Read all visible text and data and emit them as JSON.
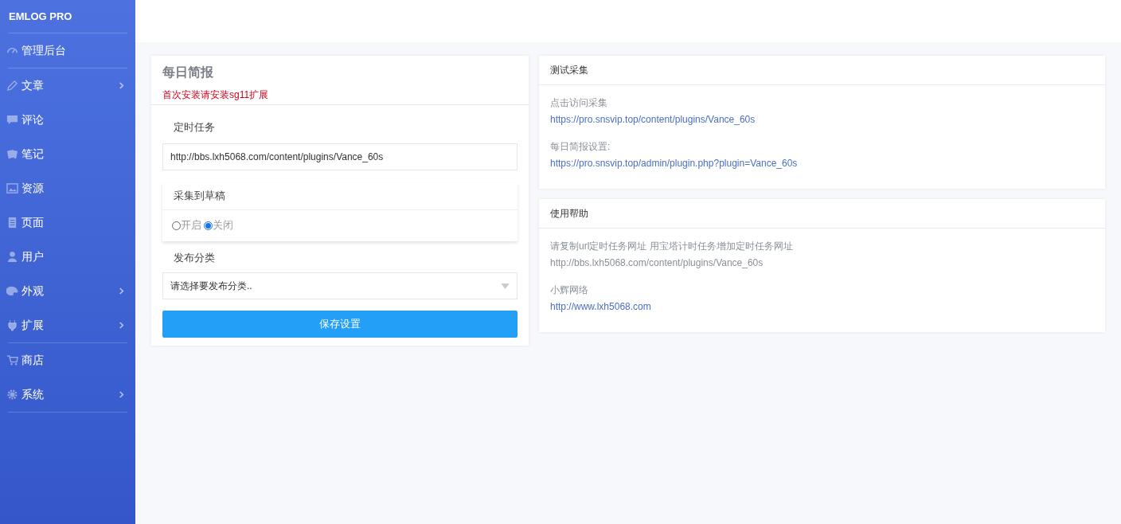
{
  "sidebar": {
    "brand": "EMLOG PRO",
    "groups": [
      [
        {
          "label": "管理后台",
          "has_submenu": false
        }
      ],
      [
        {
          "label": "文章",
          "has_submenu": true
        },
        {
          "label": "评论",
          "has_submenu": false
        },
        {
          "label": "笔记",
          "has_submenu": false
        },
        {
          "label": "资源",
          "has_submenu": false
        },
        {
          "label": "页面",
          "has_submenu": false
        },
        {
          "label": "用户",
          "has_submenu": false
        },
        {
          "label": "外观",
          "has_submenu": true
        },
        {
          "label": "扩展",
          "has_submenu": true
        }
      ],
      [
        {
          "label": "商店",
          "has_submenu": false
        },
        {
          "label": "系统",
          "has_submenu": true
        }
      ]
    ]
  },
  "settings_card": {
    "title": "每日简报",
    "notice": "首次安装请安装sg11扩展",
    "cron_label": "定时任务",
    "cron_value": "http://bbs.lxh5068.com/content/plugins/Vance_60s",
    "draft_label": "采集到草稿",
    "draft_options": [
      {
        "label": "开启",
        "selected": false
      },
      {
        "label": "关闭",
        "selected": true
      }
    ],
    "category_label": "发布分类",
    "category_placeholder": "请选择要发布分类..",
    "save_button": "保存设置"
  },
  "info_cards": [
    {
      "title": "测试采集",
      "lines": [
        {
          "text": "点击访问采集",
          "kind": "label"
        },
        {
          "text": "https://pro.snsvip.top/content/plugins/Vance_60s",
          "kind": "link"
        },
        {
          "text": "每日简报设置:",
          "kind": "label"
        },
        {
          "text": "https://pro.snsvip.top/admin/plugin.php?plugin=Vance_60s",
          "kind": "link"
        }
      ]
    },
    {
      "title": "使用帮助",
      "lines": [
        {
          "text": "请复制url定时任务网址 用宝塔计时任务增加定时任务网址",
          "kind": "label"
        },
        {
          "text": "http://bbs.lxh5068.com/content/plugins/Vance_60s",
          "kind": "plain"
        },
        {
          "text": "小辉网络",
          "kind": "label"
        },
        {
          "text": "http://www.lxh5068.com",
          "kind": "link"
        }
      ]
    }
  ]
}
